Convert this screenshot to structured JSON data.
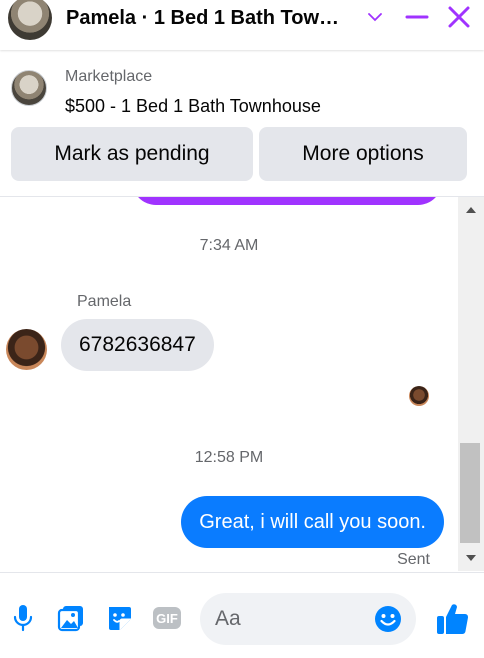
{
  "header": {
    "title": "Pamela · 1 Bed 1 Bath Tow…",
    "icons": [
      "chevron-down-icon",
      "minimize-icon",
      "close-icon"
    ],
    "accent_color": "#a033ff"
  },
  "banner": {
    "kind": "Marketplace",
    "listing_title": "$500 - 1 Bed 1 Bath Townhouse",
    "buttons": {
      "pending": "Mark as pending",
      "more": "More options"
    }
  },
  "conversation": {
    "timestamps": [
      "7:34 AM",
      "12:58 PM"
    ],
    "incoming": {
      "sender": "Pamela",
      "text": "6782636847"
    },
    "outgoing": {
      "text": "Great, i will call you soon.",
      "status": "Sent"
    },
    "colors": {
      "outgoing_bubble": "#0a7cff",
      "incoming_bubble": "#e4e6eb",
      "previous_bubble": "#a033ff"
    }
  },
  "composer": {
    "placeholder": "Aa",
    "icons": [
      "microphone-icon",
      "gallery-icon",
      "sticker-icon",
      "gif-icon",
      "emoji-icon",
      "thumbs-up-icon"
    ],
    "gif_label": "GIF",
    "accent_color": "#0084ff"
  }
}
